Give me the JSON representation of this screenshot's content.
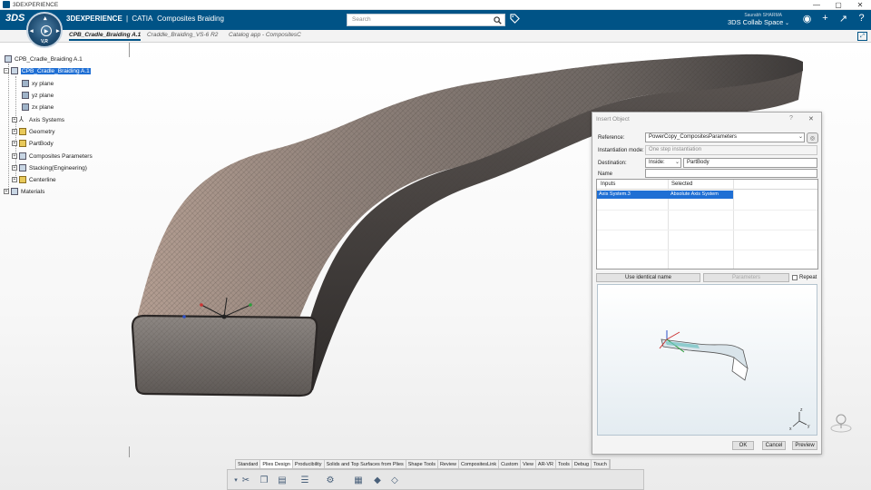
{
  "window": {
    "title": "3DEXPERIENCE",
    "controls": [
      "—",
      "▢",
      "✕"
    ]
  },
  "topbar": {
    "brand_bold": "3DEXPERIENCE",
    "brand_sep": "|",
    "brand_app": "CATIA",
    "brand_module": "Composites Braiding",
    "search_placeholder": "Search",
    "user_name": "Saurabh SHARMA",
    "collab_space": "3DS Collab Space",
    "compass_label": "V,R",
    "icons": [
      "tag-icon",
      "user-icon",
      "plus-icon",
      "share-icon",
      "help-icon"
    ]
  },
  "tabs": [
    {
      "label": "CPB_Cradle_Braiding A.1",
      "active": true
    },
    {
      "label": "Craddle_Braiding_VS-6 R2",
      "active": false
    },
    {
      "label": "Catalog app - CompositesC",
      "active": false
    }
  ],
  "tree": {
    "root": "CPB_Cradle_Braiding A.1",
    "part": "CPB_Cradle_Braiding A.1",
    "planes": [
      "xy plane",
      "yz plane",
      "zx plane"
    ],
    "nodes": [
      "Axis Systems",
      "Geometry",
      "PartBody",
      "Composites Parameters",
      "Stacking(Engineering)",
      "Centerline"
    ],
    "materials": "Materials"
  },
  "dialog": {
    "title": "Insert Object",
    "help": "?",
    "close": "✕",
    "reference_label": "Reference:",
    "reference_value": "PowerCopy_CompositesParameters",
    "instantiation_label": "Instantiation mode:",
    "instantiation_value": "One step instantiation",
    "destination_label": "Destination:",
    "destination_mode": "Inside:",
    "destination_value": "PartBody",
    "name_label": "Name",
    "name_value": "",
    "table": {
      "headers": [
        "Inputs",
        "Selected"
      ],
      "rows": [
        {
          "input": "Axis System.3",
          "selected": "Absolute Axis System"
        }
      ]
    },
    "use_identical_name": "Use identical name",
    "parameters": "Parameters",
    "repeat": "Repeat",
    "ok": "OK",
    "cancel": "Cancel",
    "preview": "Preview"
  },
  "toolbar": {
    "tabs": [
      {
        "label": "Standard",
        "active": false
      },
      {
        "label": "Plies Design",
        "active": true
      },
      {
        "label": "Producibility",
        "active": false
      },
      {
        "label": "Solids and Top Surfaces from Plies",
        "active": false
      },
      {
        "label": "Shape Tools",
        "active": false
      },
      {
        "label": "Review",
        "active": false
      },
      {
        "label": "CompositesLink",
        "active": false
      },
      {
        "label": "Custom",
        "active": false
      },
      {
        "label": "View",
        "active": false
      },
      {
        "label": "AR-VR",
        "active": false
      },
      {
        "label": "Tools",
        "active": false
      },
      {
        "label": "Debug",
        "active": false
      },
      {
        "label": "Touch",
        "active": false
      }
    ],
    "icons": [
      "cut-icon",
      "copy-icon",
      "paste-icon",
      "list-icon",
      "settings-icon",
      "table-icon",
      "plies-icon",
      "surface-icon"
    ]
  },
  "colors": {
    "topbar": "#005386",
    "selection": "#1f6fd4",
    "part": "#7a6f6a"
  }
}
